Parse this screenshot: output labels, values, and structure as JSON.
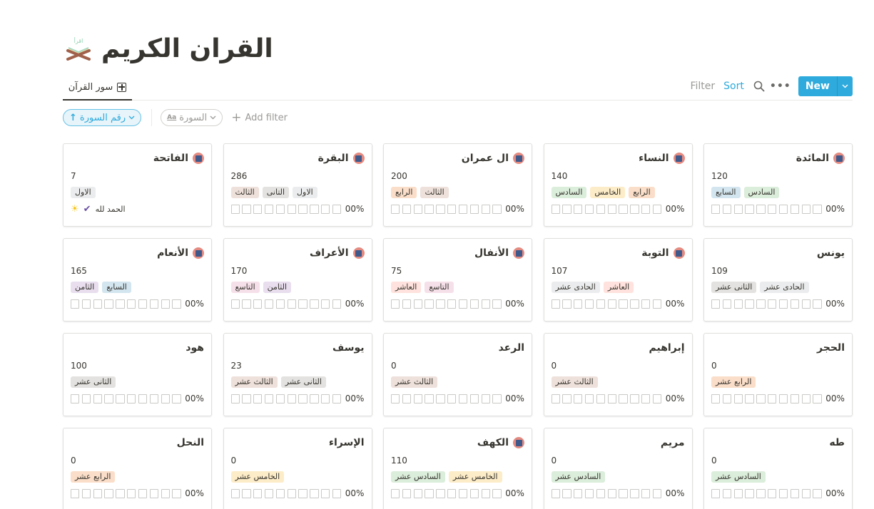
{
  "page": {
    "title": "القران الكريم",
    "icon": "quran-book-stand-icon"
  },
  "view": {
    "tab_label": "سور القرآن",
    "tab_icon": "gallery-grid-icon"
  },
  "toolbar": {
    "filter_label": "Filter",
    "sort_label": "Sort",
    "new_label": "New"
  },
  "filters": {
    "sort_pill": "رقم السورة",
    "property_pill": "السورة",
    "add_filter_label": "Add filter"
  },
  "tag_colors": {
    "الاول": "#ebeced",
    "التانى": "#e3e2e0",
    "الثالث": "#eee0da",
    "الرابع": "#fadec9",
    "الخامس": "#fdecc8",
    "السادس": "#dbeddb",
    "السابع": "#d3e5ef",
    "الثامن": "#e8deee",
    "التاسع": "#f5e0e9",
    "العاشر": "#ffe2dd",
    "الحادى عشر": "#ebeced",
    "الثانى عشر": "#e3e2e0",
    "الثالث عشر": "#eee0da",
    "الرابع عشر": "#fadec9",
    "الخامس عشر": "#fdecc8",
    "السادس عشر": "#dbeddb"
  },
  "cards": [
    {
      "name": "الفاتحة",
      "count": "7",
      "has_icon": true,
      "tags": [
        "الاول"
      ],
      "extra": "الحمد لله",
      "progress": null
    },
    {
      "name": "البقرة",
      "count": "286",
      "has_icon": true,
      "tags": [
        "الاول",
        "التانى",
        "الثالث"
      ],
      "progress": "00%"
    },
    {
      "name": "ال عمران",
      "count": "200",
      "has_icon": true,
      "tags": [
        "الثالث",
        "الرابع"
      ],
      "progress": "00%"
    },
    {
      "name": "النساء",
      "count": "140",
      "has_icon": true,
      "tags": [
        "الرابع",
        "الخامس",
        "السادس"
      ],
      "progress": "00%"
    },
    {
      "name": "المائدة",
      "count": "120",
      "has_icon": true,
      "tags": [
        "السادس",
        "السابع"
      ],
      "progress": "00%"
    },
    {
      "name": "الأنعام",
      "count": "165",
      "has_icon": true,
      "tags": [
        "السابع",
        "الثامن"
      ],
      "progress": "00%"
    },
    {
      "name": "الأعراف",
      "count": "170",
      "has_icon": true,
      "tags": [
        "الثامن",
        "التاسع"
      ],
      "progress": "00%"
    },
    {
      "name": "الأنفال",
      "count": "75",
      "has_icon": true,
      "tags": [
        "التاسع",
        "العاشر"
      ],
      "progress": "00%"
    },
    {
      "name": "التوبة",
      "count": "107",
      "has_icon": true,
      "tags": [
        "العاشر",
        "الحادى عشر"
      ],
      "progress": "00%"
    },
    {
      "name": "يونس",
      "count": "109",
      "has_icon": false,
      "tags": [
        "الحادى عشر",
        "الثانى عشر"
      ],
      "progress": "00%"
    },
    {
      "name": "هود",
      "count": "100",
      "has_icon": false,
      "tags": [
        "الثانى عشر"
      ],
      "progress": "00%"
    },
    {
      "name": "يوسف",
      "count": "23",
      "has_icon": false,
      "tags": [
        "الثانى عشر",
        "الثالث عشر"
      ],
      "progress": "00%"
    },
    {
      "name": "الرعد",
      "count": "0",
      "has_icon": false,
      "tags": [
        "الثالث عشر"
      ],
      "progress": "00%"
    },
    {
      "name": "إبراهيم",
      "count": "0",
      "has_icon": false,
      "tags": [
        "الثالث عشر"
      ],
      "progress": "00%"
    },
    {
      "name": "الحجر",
      "count": "0",
      "has_icon": false,
      "tags": [
        "الرابع عشر"
      ],
      "progress": "00%"
    },
    {
      "name": "النحل",
      "count": "0",
      "has_icon": false,
      "tags": [
        "الرابع عشر"
      ],
      "progress": "00%"
    },
    {
      "name": "الإسراء",
      "count": "0",
      "has_icon": false,
      "tags": [
        "الخامس عشر"
      ],
      "progress": "00%"
    },
    {
      "name": "الكهف",
      "count": "110",
      "has_icon": true,
      "tags": [
        "الخامس عشر",
        "السادس عشر"
      ],
      "progress": "00%"
    },
    {
      "name": "مريم",
      "count": "0",
      "has_icon": false,
      "tags": [
        "السادس عشر"
      ],
      "progress": "00%"
    },
    {
      "name": "طه",
      "count": "0",
      "has_icon": false,
      "tags": [
        "السادس عشر"
      ],
      "progress": "00%"
    }
  ]
}
